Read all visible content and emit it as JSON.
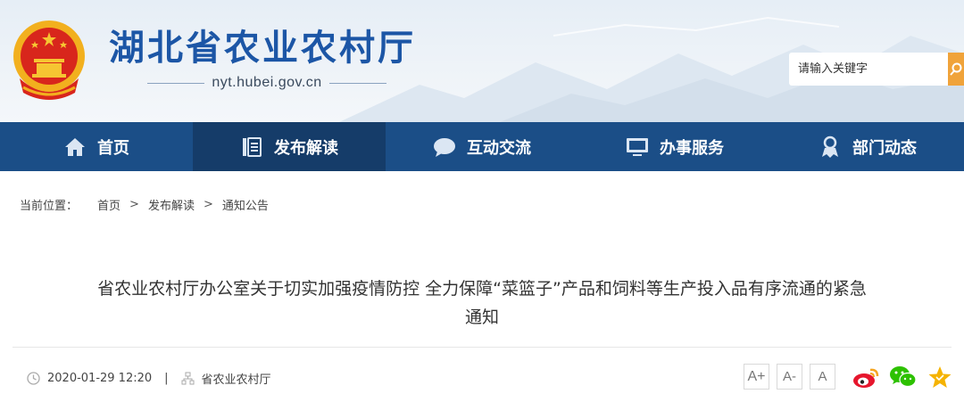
{
  "header": {
    "site_title": "湖北省农业农村厅",
    "site_domain": "nyt.hubei.gov.cn",
    "emblem_icon": "national-emblem-icon",
    "search": {
      "placeholder": "请输入关键字",
      "icon": "search-icon"
    }
  },
  "nav": {
    "items": [
      {
        "label": "首页",
        "icon": "home-icon",
        "active": false
      },
      {
        "label": "发布解读",
        "icon": "document-icon",
        "active": true
      },
      {
        "label": "互动交流",
        "icon": "chat-bubble-icon",
        "active": false
      },
      {
        "label": "办事服务",
        "icon": "monitor-icon",
        "active": false
      },
      {
        "label": "部门动态",
        "icon": "badge-person-icon",
        "active": false
      }
    ]
  },
  "breadcrumb": {
    "label": "当前位置：",
    "items": [
      "首页",
      "发布解读",
      "通知公告"
    ],
    "separator": ">"
  },
  "article": {
    "title_line1": "省农业农村厅办公室关于切实加强疫情防控 全力保障“菜篮子”产品和饲料等生产投入品有序流通的紧急",
    "title_line2": "通知",
    "date": "2020-01-29 12:20",
    "meta_separator": "|",
    "source": "省农业农村厅"
  },
  "font_size_buttons": [
    "A+",
    "A-",
    "A"
  ],
  "share": {
    "icons": [
      "weibo-icon",
      "wechat-icon",
      "favorite-star-icon"
    ]
  },
  "colors": {
    "nav_bg": "#1b4e87",
    "nav_active_bg": "#153c69",
    "title_blue": "#1c56a6",
    "search_orange": "#f0a33a"
  }
}
